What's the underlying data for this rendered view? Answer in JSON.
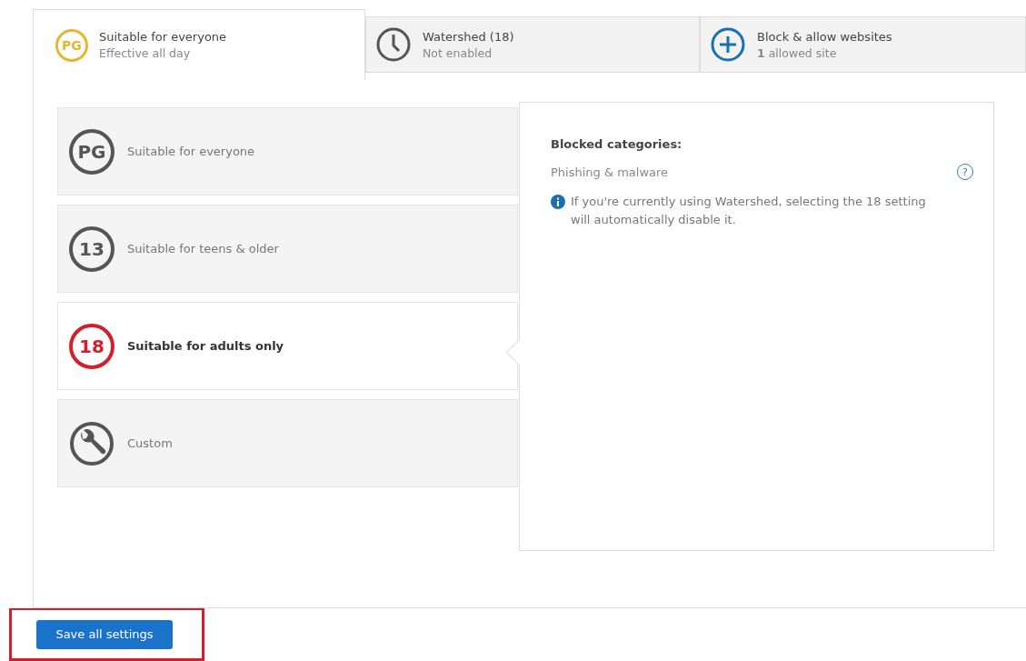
{
  "tabs": [
    {
      "kind": "badge",
      "badge": "PG",
      "label": "Suitable for everyone",
      "sub": "Effective all day",
      "selected": true
    },
    {
      "kind": "clock",
      "label": "Watershed (18)",
      "sub": "Not enabled",
      "selected": false
    },
    {
      "kind": "plus",
      "label": "Block & allow websites",
      "sub": "**1** allowed site",
      "selected": false
    }
  ],
  "options": [
    {
      "kind": "badge",
      "badge": "PG",
      "label": "Suitable for everyone",
      "selected": false
    },
    {
      "kind": "badge",
      "badge": "13",
      "label": "Suitable for teens & older",
      "selected": false
    },
    {
      "kind": "badge",
      "badge": "18",
      "label": "Suitable for adults only",
      "selected": true
    },
    {
      "kind": "wrench",
      "label": "Custom",
      "selected": false
    }
  ],
  "details": {
    "heading": "Blocked categories:",
    "category": "Phishing & malware",
    "help": "?",
    "note": "If you're currently using Watershed, selecting the 18 setting will automatically disable it."
  },
  "save_button": "Save all settings"
}
